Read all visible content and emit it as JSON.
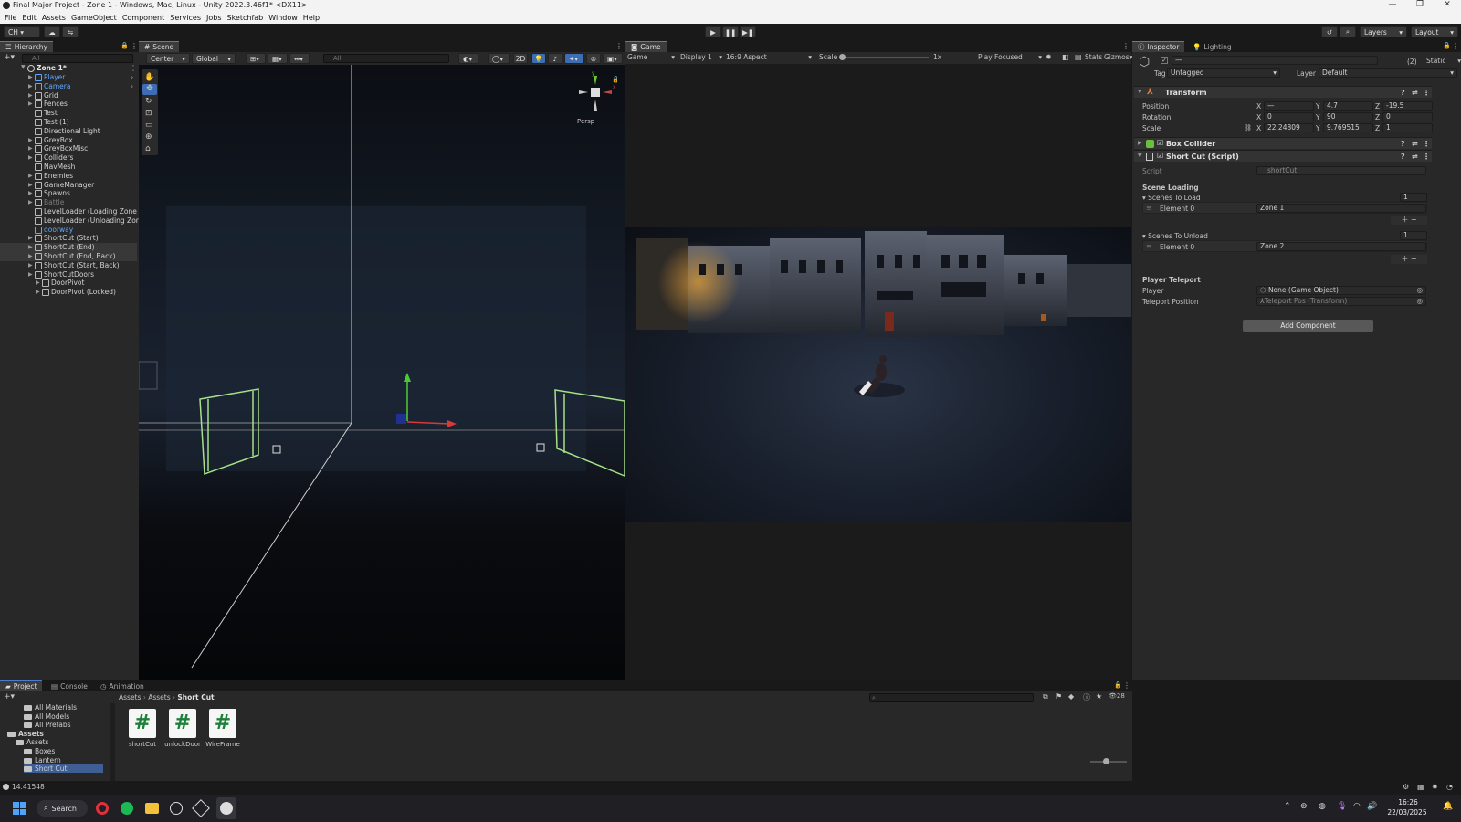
{
  "window": {
    "title": "Final Major Project - Zone 1 - Windows, Mac, Linux - Unity 2022.3.46f1* <DX11>"
  },
  "menu": [
    "File",
    "Edit",
    "Assets",
    "GameObject",
    "Component",
    "Services",
    "Jobs",
    "Sketchfab",
    "Window",
    "Help"
  ],
  "toolbar": {
    "account": "CH",
    "layers": "Layers",
    "layout": "Layout"
  },
  "hierarchy": {
    "tab": "Hierarchy",
    "search_placeholder": "All",
    "scene": "Zone 1*",
    "items": [
      {
        "label": "Player",
        "indent": 1,
        "style": "blue",
        "arrow": true
      },
      {
        "label": "Camera",
        "indent": 1,
        "style": "blue",
        "arrow": true
      },
      {
        "label": "Grid",
        "indent": 1,
        "style": "",
        "arrow": true
      },
      {
        "label": "Fences",
        "indent": 1,
        "style": "",
        "arrow": true
      },
      {
        "label": "Test",
        "indent": 1,
        "style": "",
        "arrow": false
      },
      {
        "label": "Test (1)",
        "indent": 1,
        "style": "",
        "arrow": false
      },
      {
        "label": "Directional Light",
        "indent": 1,
        "style": "",
        "arrow": false
      },
      {
        "label": "GreyBox",
        "indent": 1,
        "style": "",
        "arrow": true
      },
      {
        "label": "GreyBoxMisc",
        "indent": 1,
        "style": "",
        "arrow": true
      },
      {
        "label": "Colliders",
        "indent": 1,
        "style": "",
        "arrow": true
      },
      {
        "label": "NavMesh",
        "indent": 1,
        "style": "",
        "arrow": false
      },
      {
        "label": "Enemies",
        "indent": 1,
        "style": "",
        "arrow": true
      },
      {
        "label": "GameManager",
        "indent": 1,
        "style": "",
        "arrow": true
      },
      {
        "label": "Spawns",
        "indent": 1,
        "style": "",
        "arrow": true
      },
      {
        "label": "Battle",
        "indent": 1,
        "style": "dim",
        "arrow": true
      },
      {
        "label": "LevelLoader (Loading Zone 2)",
        "indent": 1,
        "style": "",
        "arrow": false
      },
      {
        "label": "LevelLoader (Unloading Zone 2)",
        "indent": 1,
        "style": "",
        "arrow": false
      },
      {
        "label": "doorway",
        "indent": 1,
        "style": "blue",
        "arrow": false
      },
      {
        "label": "ShortCut (Start)",
        "indent": 1,
        "style": "",
        "arrow": true
      },
      {
        "label": "ShortCut (End)",
        "indent": 1,
        "style": "sel",
        "arrow": true
      },
      {
        "label": "ShortCut (End, Back)",
        "indent": 1,
        "style": "sel",
        "arrow": true
      },
      {
        "label": "ShortCut (Start, Back)",
        "indent": 1,
        "style": "",
        "arrow": true
      },
      {
        "label": "ShortCutDoors",
        "indent": 1,
        "style": "",
        "arrow": true
      },
      {
        "label": "DoorPivot",
        "indent": 2,
        "style": "",
        "arrow": true
      },
      {
        "label": "DoorPivot (Locked)",
        "indent": 2,
        "style": "",
        "arrow": true
      }
    ]
  },
  "scene_view": {
    "tab": "Scene",
    "pivot": "Center",
    "space": "Global",
    "search_placeholder": "All",
    "mode_2d": "2D",
    "persp": "Persp"
  },
  "game_view": {
    "tab": "Game",
    "mode": "Game",
    "display": "Display 1",
    "aspect": "16:9 Aspect",
    "scale_label": "Scale",
    "scale_value": "1x",
    "play_mode": "Play Focused",
    "stats": "Stats",
    "gizmos": "Gizmos"
  },
  "inspector": {
    "tabs": [
      "Inspector",
      "Lighting"
    ],
    "name_value": "—",
    "count": "(2)",
    "static": "Static",
    "tag_label": "Tag",
    "tag_value": "Untagged",
    "layer_label": "Layer",
    "layer_value": "Default",
    "transform": {
      "title": "Transform",
      "position_label": "Position",
      "rotation_label": "Rotation",
      "scale_label": "Scale",
      "position": {
        "x": "—",
        "y": "4.7",
        "z": "-19.5"
      },
      "rotation": {
        "x": "0",
        "y": "90",
        "z": "0"
      },
      "scale": {
        "x": "22.24809",
        "y": "9.769515",
        "z": "1"
      }
    },
    "box_collider": "Box Collider",
    "script_comp": {
      "title": "Short Cut (Script)",
      "script_label": "Script",
      "script_value": "shortCut",
      "section1": "Scene Loading",
      "scenes_to_load": "Scenes To Load",
      "load_count": "1",
      "element_label": "Element 0",
      "load_el0": "Zone 1",
      "scenes_to_unload": "Scenes To Unload",
      "unload_count": "1",
      "unload_el0": "Zone 2",
      "section2": "Player Teleport",
      "player_label": "Player",
      "player_value": "None (Game Object)",
      "teleport_label": "Teleport Position",
      "teleport_value": "Teleport Pos (Transform)"
    },
    "add_component": "Add Component"
  },
  "project": {
    "tabs": [
      "Project",
      "Console",
      "Animation"
    ],
    "count": "28",
    "tree": [
      {
        "label": "All Materials",
        "indent": 2
      },
      {
        "label": "All Models",
        "indent": 2
      },
      {
        "label": "All Prefabs",
        "indent": 2
      },
      {
        "label": "Assets",
        "indent": 0,
        "bold": true
      },
      {
        "label": "Assets",
        "indent": 1
      },
      {
        "label": "Boxes",
        "indent": 2
      },
      {
        "label": "Lantern",
        "indent": 2
      },
      {
        "label": "Short Cut",
        "indent": 2
      }
    ],
    "breadcrumb": [
      "Assets",
      "Assets",
      "Short Cut"
    ],
    "assets": [
      "shortCut",
      "unlockDoor",
      "WireFrame"
    ]
  },
  "status": {
    "value": "14.41548"
  },
  "taskbar": {
    "search": "Search",
    "time": "16:26",
    "date": "22/03/2025"
  }
}
